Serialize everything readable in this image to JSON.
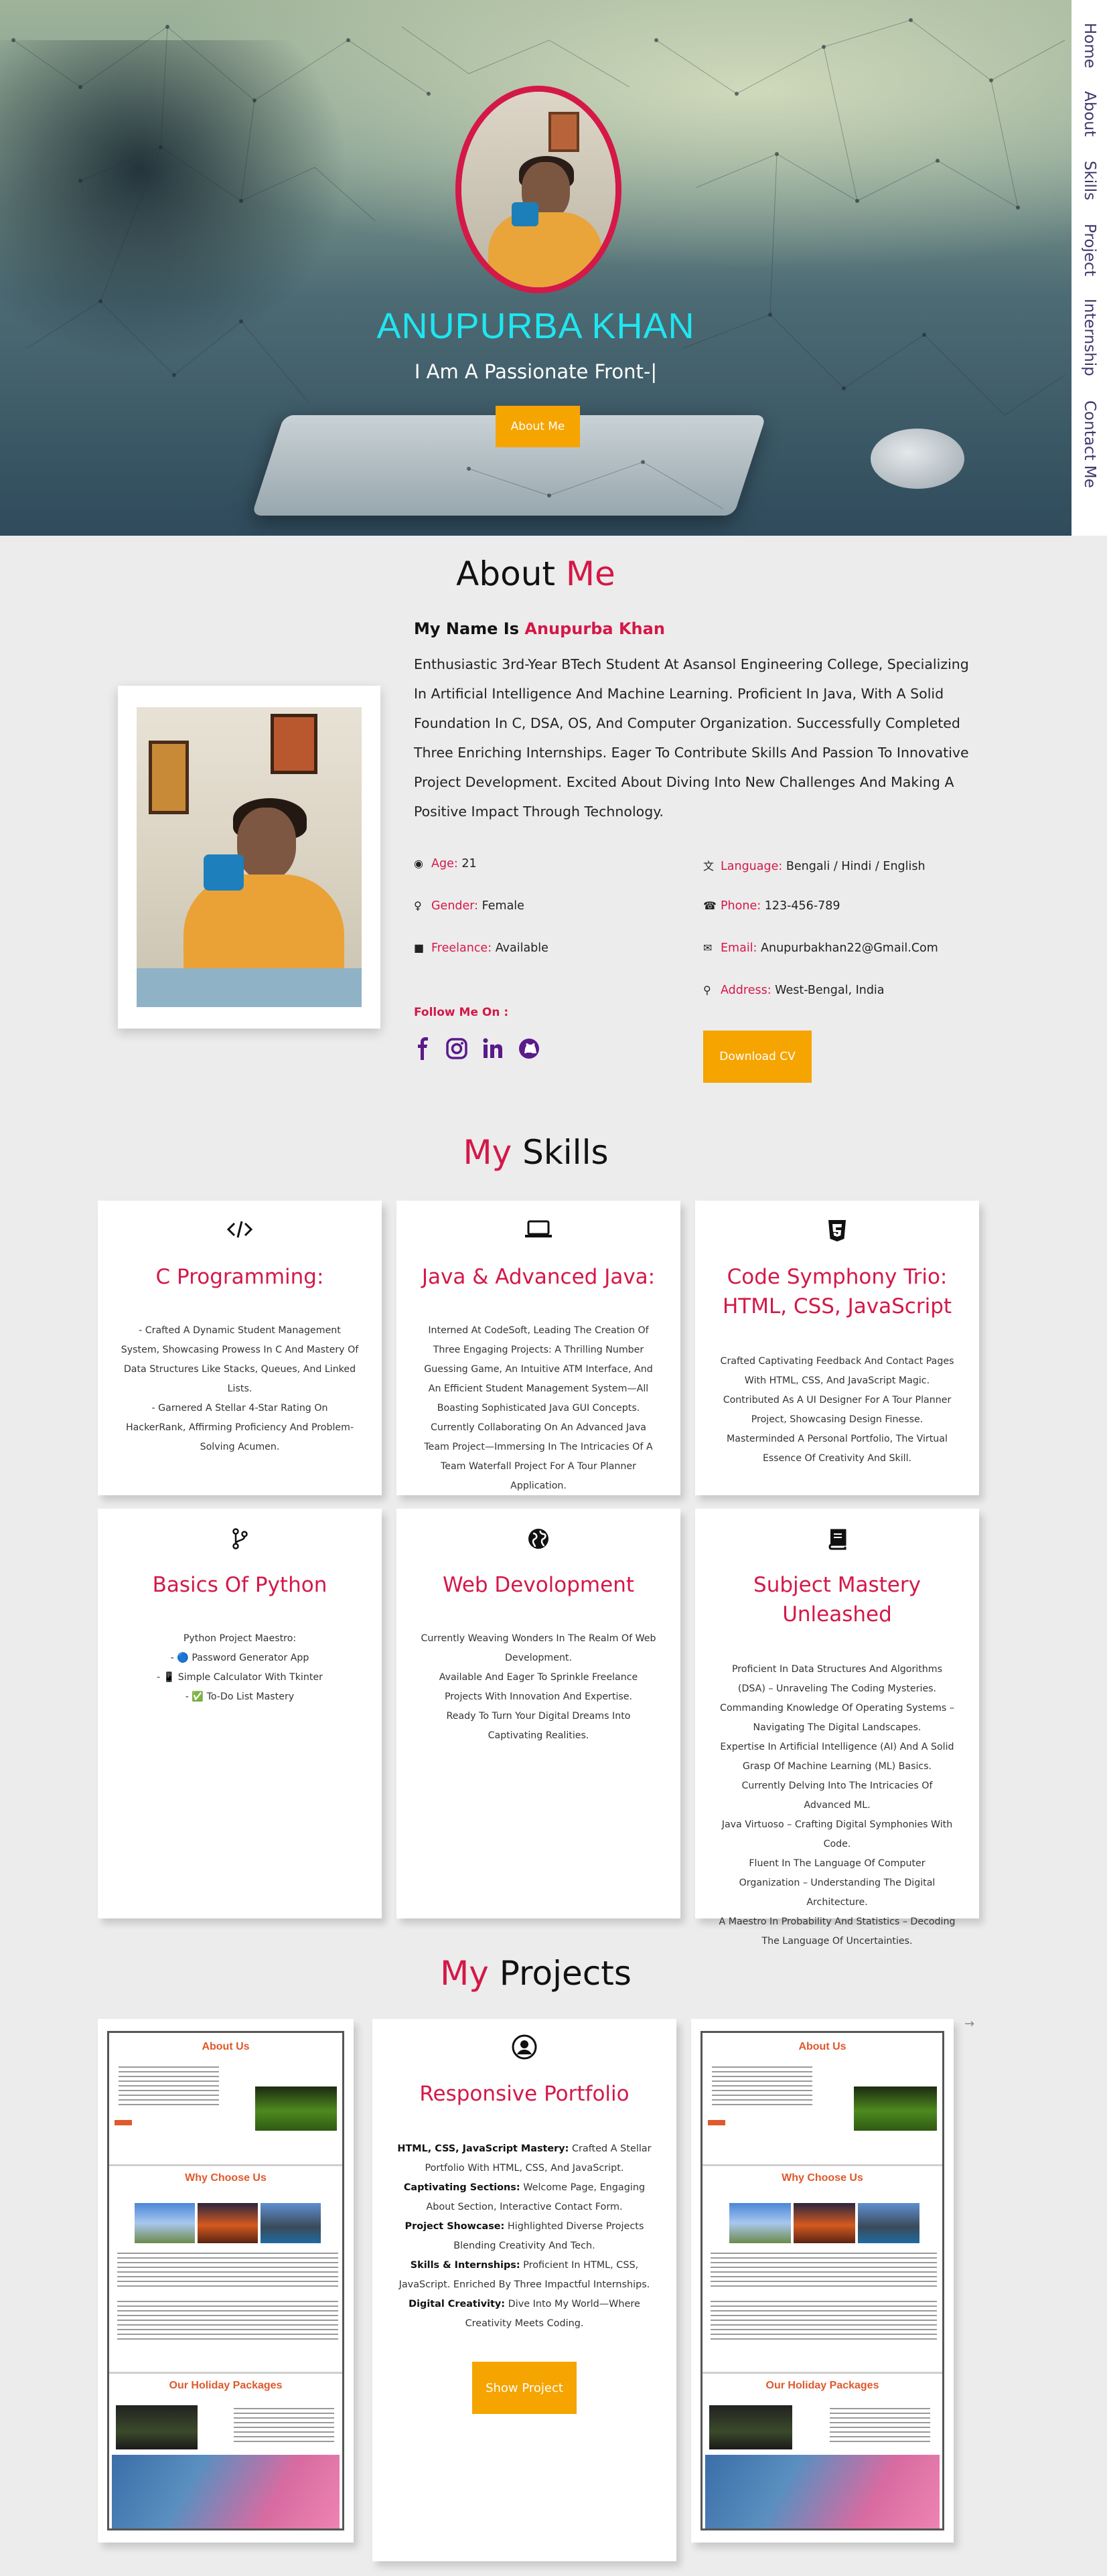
{
  "hero": {
    "name": "ANUPURBA KHAN",
    "tagline": "I Am A Passionate Front-|",
    "cta_label": "About Me"
  },
  "nav": {
    "items": [
      "Home",
      "About",
      "Skills",
      "Project",
      "Internship",
      "Contact Me"
    ]
  },
  "about": {
    "title_plain": "About ",
    "title_accent": "Me",
    "name_prefix": "My Name Is ",
    "name": "Anupurba Khan",
    "bio": "Enthusiastic 3rd-Year BTech Student At Asansol Engineering College, Specializing In Artificial Intelligence And Machine Learning. Proficient In Java, With A Solid Foundation In C, DSA, OS, And Computer Organization. Successfully Completed Three Enriching Internships. Eager To Contribute Skills And Passion To Innovative Project Development. Excited About Diving Into New Challenges And Making A Positive Impact Through Technology.",
    "details": {
      "age_label": "Age:",
      "age": "21",
      "gender_label": "Gender:",
      "gender": "Female",
      "freelance_label": "Freelance:",
      "freelance": "Available",
      "language_label": "Language:",
      "language": "Bengali / Hindi / English",
      "phone_label": "Phone:",
      "phone": "123-456-789",
      "email_label": "Email:",
      "email": "Anupurbakhan22@Gmail.Com",
      "address_label": "Address:",
      "address": "West-Bengal, India"
    },
    "follow_label": "Follow Me On :",
    "socials": [
      "facebook-icon",
      "instagram-icon",
      "linkedin-icon",
      "github-icon"
    ],
    "download_label": "Download CV"
  },
  "skills": {
    "title_accent": "My",
    "title_plain": " Skills",
    "cards": [
      {
        "icon": "code-icon",
        "title": "C Programming:",
        "lines": [
          "- Crafted A Dynamic Student Management System, Showcasing Prowess In C And Mastery Of Data Structures Like Stacks, Queues, And Linked Lists.",
          "- Garnered A Stellar 4-Star Rating On HackerRank, Affirming Proficiency And Problem-Solving Acumen."
        ]
      },
      {
        "icon": "laptop-icon",
        "title": "Java & Advanced Java:",
        "lines": [
          "Interned At CodeSoft, Leading The Creation Of Three Engaging Projects: A Thrilling Number Guessing Game, An Intuitive ATM Interface, And An Efficient Student Management System—All Boasting Sophisticated Java GUI Concepts. Currently Collaborating On An Advanced Java Team Project—Immersing In The Intricacies Of A Team Waterfall Project For A Tour Planner Application."
        ]
      },
      {
        "icon": "html5-icon",
        "title": "Code Symphony Trio: HTML, CSS, JavaScript",
        "lines": [
          "Crafted Captivating Feedback And Contact Pages With HTML, CSS, And JavaScript Magic.",
          "Contributed As A UI Designer For A Tour Planner Project, Showcasing Design Finesse.",
          "Masterminded A Personal Portfolio, The Virtual Essence Of Creativity And Skill."
        ]
      },
      {
        "icon": "code-branch-icon",
        "title": "Basics Of Python",
        "lines": [
          "Python Project Maestro:",
          "- 🔵 Password Generator App",
          "- 📱 Simple Calculator With Tkinter",
          "- ✅ To-Do List Mastery"
        ]
      },
      {
        "icon": "globe-icon",
        "title": "Web Devolopment",
        "lines": [
          "Currently Weaving Wonders In The Realm Of Web Development.",
          "Available And Eager To Sprinkle Freelance Projects With Innovation And Expertise.",
          "Ready To Turn Your Digital Dreams Into Captivating Realities."
        ]
      },
      {
        "icon": "book-icon",
        "title": "Subject Mastery Unleashed",
        "lines": [
          "Proficient In Data Structures And Algorithms (DSA) – Unraveling The Coding Mysteries.",
          "Commanding Knowledge Of Operating Systems – Navigating The Digital Landscapes.",
          "Expertise In Artificial Intelligence (AI) And A Solid Grasp Of Machine Learning (ML) Basics.",
          "Currently Delving Into The Intricacies Of Advanced ML.",
          "Java Virtuoso – Crafting Digital Symphonies With Code.",
          "Fluent In The Language Of Computer Organization – Understanding The Digital Architecture.",
          "A Maestro In Probability And Statistics – Decoding The Language Of Uncertainties."
        ]
      }
    ]
  },
  "projects": {
    "title_accent": "My",
    "title_plain": " Projects",
    "screenshot_headings": [
      "About Us",
      "Why Choose Us",
      "Our Holiday Packages"
    ],
    "card": {
      "icon": "user-circle-icon",
      "title": "Responsive Portfolio",
      "items": [
        {
          "label": "HTML, CSS, JavaScript Mastery:",
          "text": " Crafted A Stellar Portfolio With HTML, CSS, And JavaScript."
        },
        {
          "label": "Captivating Sections:",
          "text": " Welcome Page, Engaging About Section, Interactive Contact Form."
        },
        {
          "label": "Project Showcase:",
          "text": " Highlighted Diverse Projects Blending Creativity And Tech."
        },
        {
          "label": "Skills & Internships:",
          "text": " Proficient In HTML, CSS, JavaScript. Enriched By Three Impactful Internships."
        },
        {
          "label": "Digital Creativity:",
          "text": " Dive Into My World—Where Creativity Meets Coding."
        }
      ],
      "button_label": "Show Project"
    },
    "next_arrow": "→"
  },
  "colors": {
    "accent": "#d41848",
    "button": "#f5a400",
    "hero_name": "#1fe6f0",
    "nav_text": "#3e3a6e",
    "social": "#5a1a8a"
  }
}
